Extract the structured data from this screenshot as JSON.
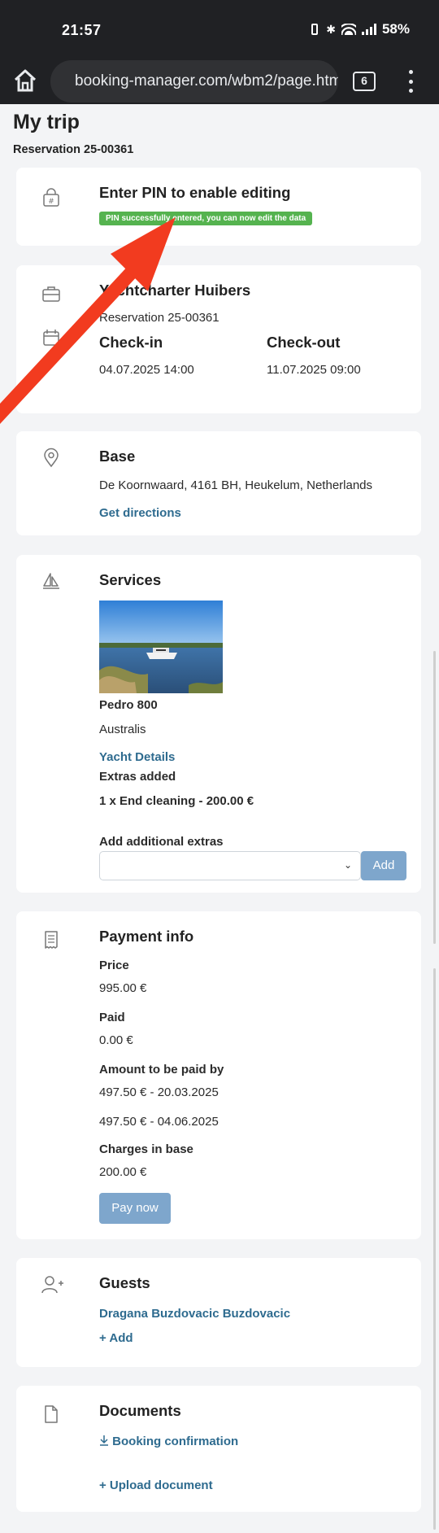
{
  "status_bar": {
    "time": "21:57",
    "battery": "58%"
  },
  "browser": {
    "url": "booking-manager.com/wbm2/page.htm",
    "tab_count": "6"
  },
  "page": {
    "title": "My trip",
    "reservation": "Reservation 25-00361"
  },
  "pin_card": {
    "title": "Enter PIN to enable editing",
    "badge": "PIN successfully entered, you can now edit the data"
  },
  "charter_card": {
    "company": "Yachtcharter Huibers",
    "reservation": "Reservation 25-00361",
    "checkin_label": "Check-in",
    "checkin_value": "04.07.2025 14:00",
    "checkout_label": "Check-out",
    "checkout_value": "11.07.2025 09:00"
  },
  "base_card": {
    "title": "Base",
    "address": "De Koornwaard, 4161 BH, Heukelum, Netherlands",
    "directions": "Get directions"
  },
  "services_card": {
    "title": "Services",
    "yacht_name": "Pedro 800",
    "yacht_country": "Australis",
    "yacht_details": "Yacht Details",
    "extras_label": "Extras added",
    "extras_item": "1 x End cleaning - 200.00 €",
    "add_extras_label": "Add additional extras",
    "add_button": "Add"
  },
  "payment_card": {
    "title": "Payment info",
    "price_label": "Price",
    "price_value": "995.00 €",
    "paid_label": "Paid",
    "paid_value": "0.00 €",
    "due_label": "Amount to be paid by",
    "due_1": "497.50 € - 20.03.2025",
    "due_2": "497.50 € - 04.06.2025",
    "charges_label": "Charges in base",
    "charges_value": "200.00 €",
    "pay_button": "Pay now"
  },
  "guests_card": {
    "title": "Guests",
    "guest": "Dragana Buzdovacic Buzdovacic",
    "add": "+ Add"
  },
  "documents_card": {
    "title": "Documents",
    "booking_confirmation": "Booking confirmation",
    "upload": "+ Upload document"
  },
  "colors": {
    "accent_link": "#2e6b8f",
    "success": "#55b34f",
    "button": "#7ea6cc",
    "annotation_arrow": "#f23b1f"
  }
}
